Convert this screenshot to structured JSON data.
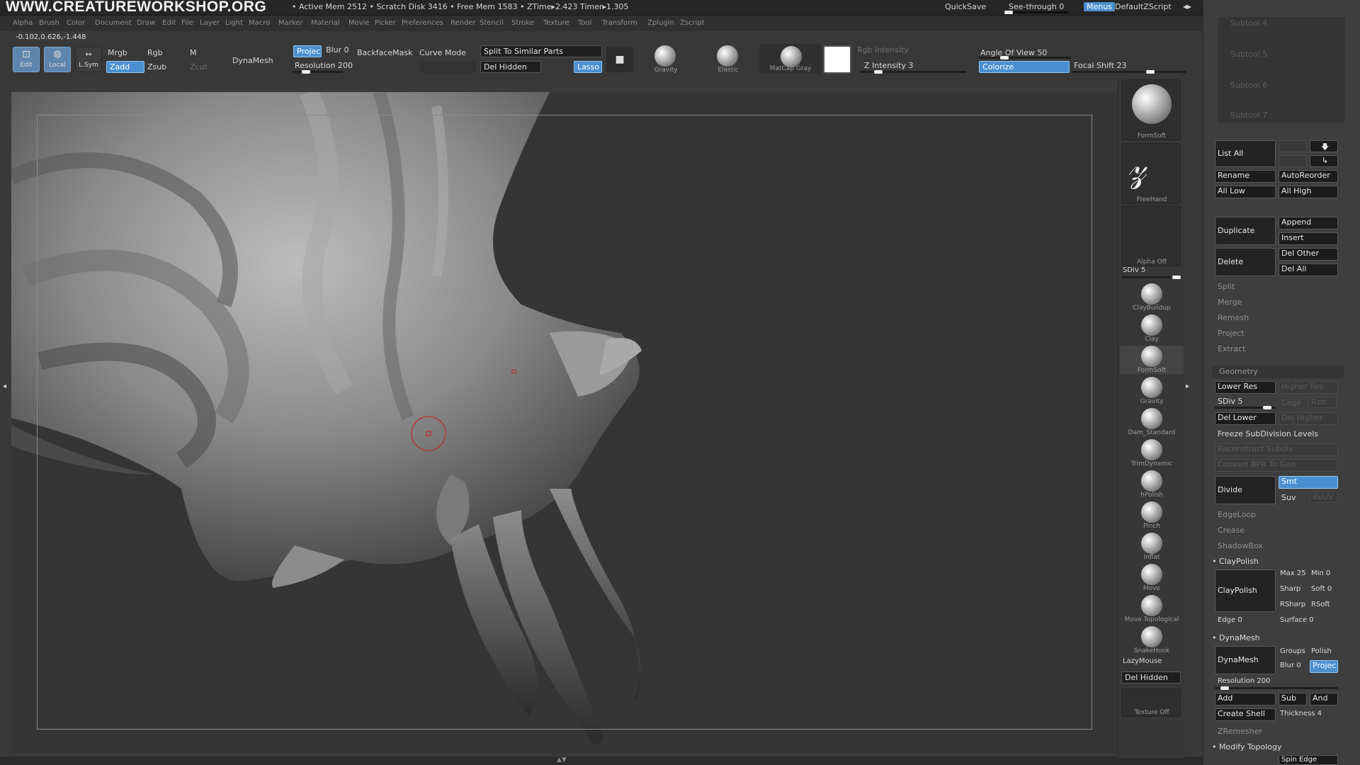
{
  "titlebar": {
    "watermark": "WWW.CREATUREWORKSHOP.ORG",
    "stats": "• Active Mem 2512 • Scratch Disk 3416 • Free Mem 1583 • ZTime▸2.423 Timer▸1.305",
    "quicksave": "QuickSave",
    "see_through": "See-through  0",
    "menus": "Menus",
    "script": "DefaultZScript"
  },
  "menubar": [
    "Alpha",
    "Brush",
    "Color",
    "Document",
    "Draw",
    "Edit",
    "File",
    "Layer",
    "Light",
    "Macro",
    "Marker",
    "Material",
    "Movie",
    "Picker",
    "Preferences",
    "Render",
    "Stencil",
    "Stroke",
    "Texture",
    "Tool",
    "Transform",
    "Zplugin",
    "Zscript"
  ],
  "coords": "-0.102,0.626,-1.448",
  "toolbar": {
    "edit": "Edit",
    "local": "Local",
    "lsym": "L.Sym",
    "mrgb": "Mrgb",
    "rgb": "Rgb",
    "m": "M",
    "zadd": "Zadd",
    "zsub": "Zsub",
    "zcut": "Zcut",
    "dynamesh": "DynaMesh",
    "project": "Projec",
    "blur": "Blur 0",
    "backfacemask": "BackfaceMask",
    "curve_mode": "Curve Mode",
    "resolution": "Resolution 200",
    "split": "Split To Similar Parts",
    "del_hidden": "Del Hidden",
    "lasso": "Lasso",
    "gravity": "Gravity",
    "elastic": "Elastic",
    "matcap": "MatCap Gray",
    "rgb_intensity": "Rgb Intensity",
    "z_intensity": "Z Intensity 3",
    "angle_of_view": "Angle Of View 50",
    "colorize": "Colorize",
    "focal_shift": "Focal Shift 23"
  },
  "shelf": {
    "formsoft": "FormSoft",
    "freehand": "FreeHand",
    "alpha_off": "Alpha Off",
    "sdiv": "SDiv 5",
    "brushes": [
      "ClayBuildup",
      "Clay",
      "FormSoft",
      "Gravity",
      "Dam_Standard",
      "TrimDynamic",
      "hPolish",
      "Pinch",
      "Inflat",
      "Move",
      "Move Topological",
      "SnakeHook"
    ],
    "lazymouse": "LazyMouse",
    "del_hidden": "Del Hidden",
    "texture_off": "Texture Off"
  },
  "panel": {
    "subtools_faded": [
      "Subtool 4",
      "Subtool 5",
      "Subtool 6",
      "Subtool 7"
    ],
    "list_all": "List  All",
    "rename": "Rename",
    "autoreorder": "AutoReorder",
    "all_low": "All Low",
    "all_high": "All High",
    "duplicate": "Duplicate",
    "append": "Append",
    "insert": "Insert",
    "delete": "Delete",
    "del_other": "Del Other",
    "del_all": "Del All",
    "split": "Split",
    "merge": "Merge",
    "remesh": "Remesh",
    "project": "Project",
    "extract": "Extract",
    "geometry": "Geometry",
    "lower_res": "Lower Res",
    "higher_res": "Higher Res",
    "sdiv": "SDiv 5",
    "cage": "Cage",
    "rstr": "Rstr",
    "del_lower": "Del Lower",
    "del_higher": "Del Higher",
    "freeze": "Freeze SubDivision Levels",
    "reconstruct": "Reconstruct Subdiv",
    "convert_bpr": "Convert BPR To Geo",
    "divide": "Divide",
    "smt": "Smt",
    "suv": "Suv",
    "reuv": "ReUV",
    "edgeloop": "EdgeLoop",
    "crease": "Crease",
    "shadowbox": "ShadowBox",
    "claypolish_header": "ClayPolish",
    "claypolish": "ClayPolish",
    "max": "Max 25",
    "min": "Min 0",
    "sharp": "Sharp",
    "soft": "Soft 0",
    "rsharp": "RSharp",
    "rsoft": "RSoft",
    "edge": "Edge 0",
    "surface": "Surface 0",
    "dynamesh_header": "DynaMesh",
    "dynamesh": "DynaMesh",
    "groups": "Groups",
    "polish": "Polish",
    "blur": "Blur 0",
    "projec": "Projec",
    "resolution": "Resolution 200",
    "add": "Add",
    "sub": "Sub",
    "and": "And",
    "create_shell": "Create Shell",
    "thickness": "Thickness 4",
    "zremesher": "ZRemesher",
    "modify_topology": "Modify Topology",
    "spin_edge": "Spin Edge"
  }
}
